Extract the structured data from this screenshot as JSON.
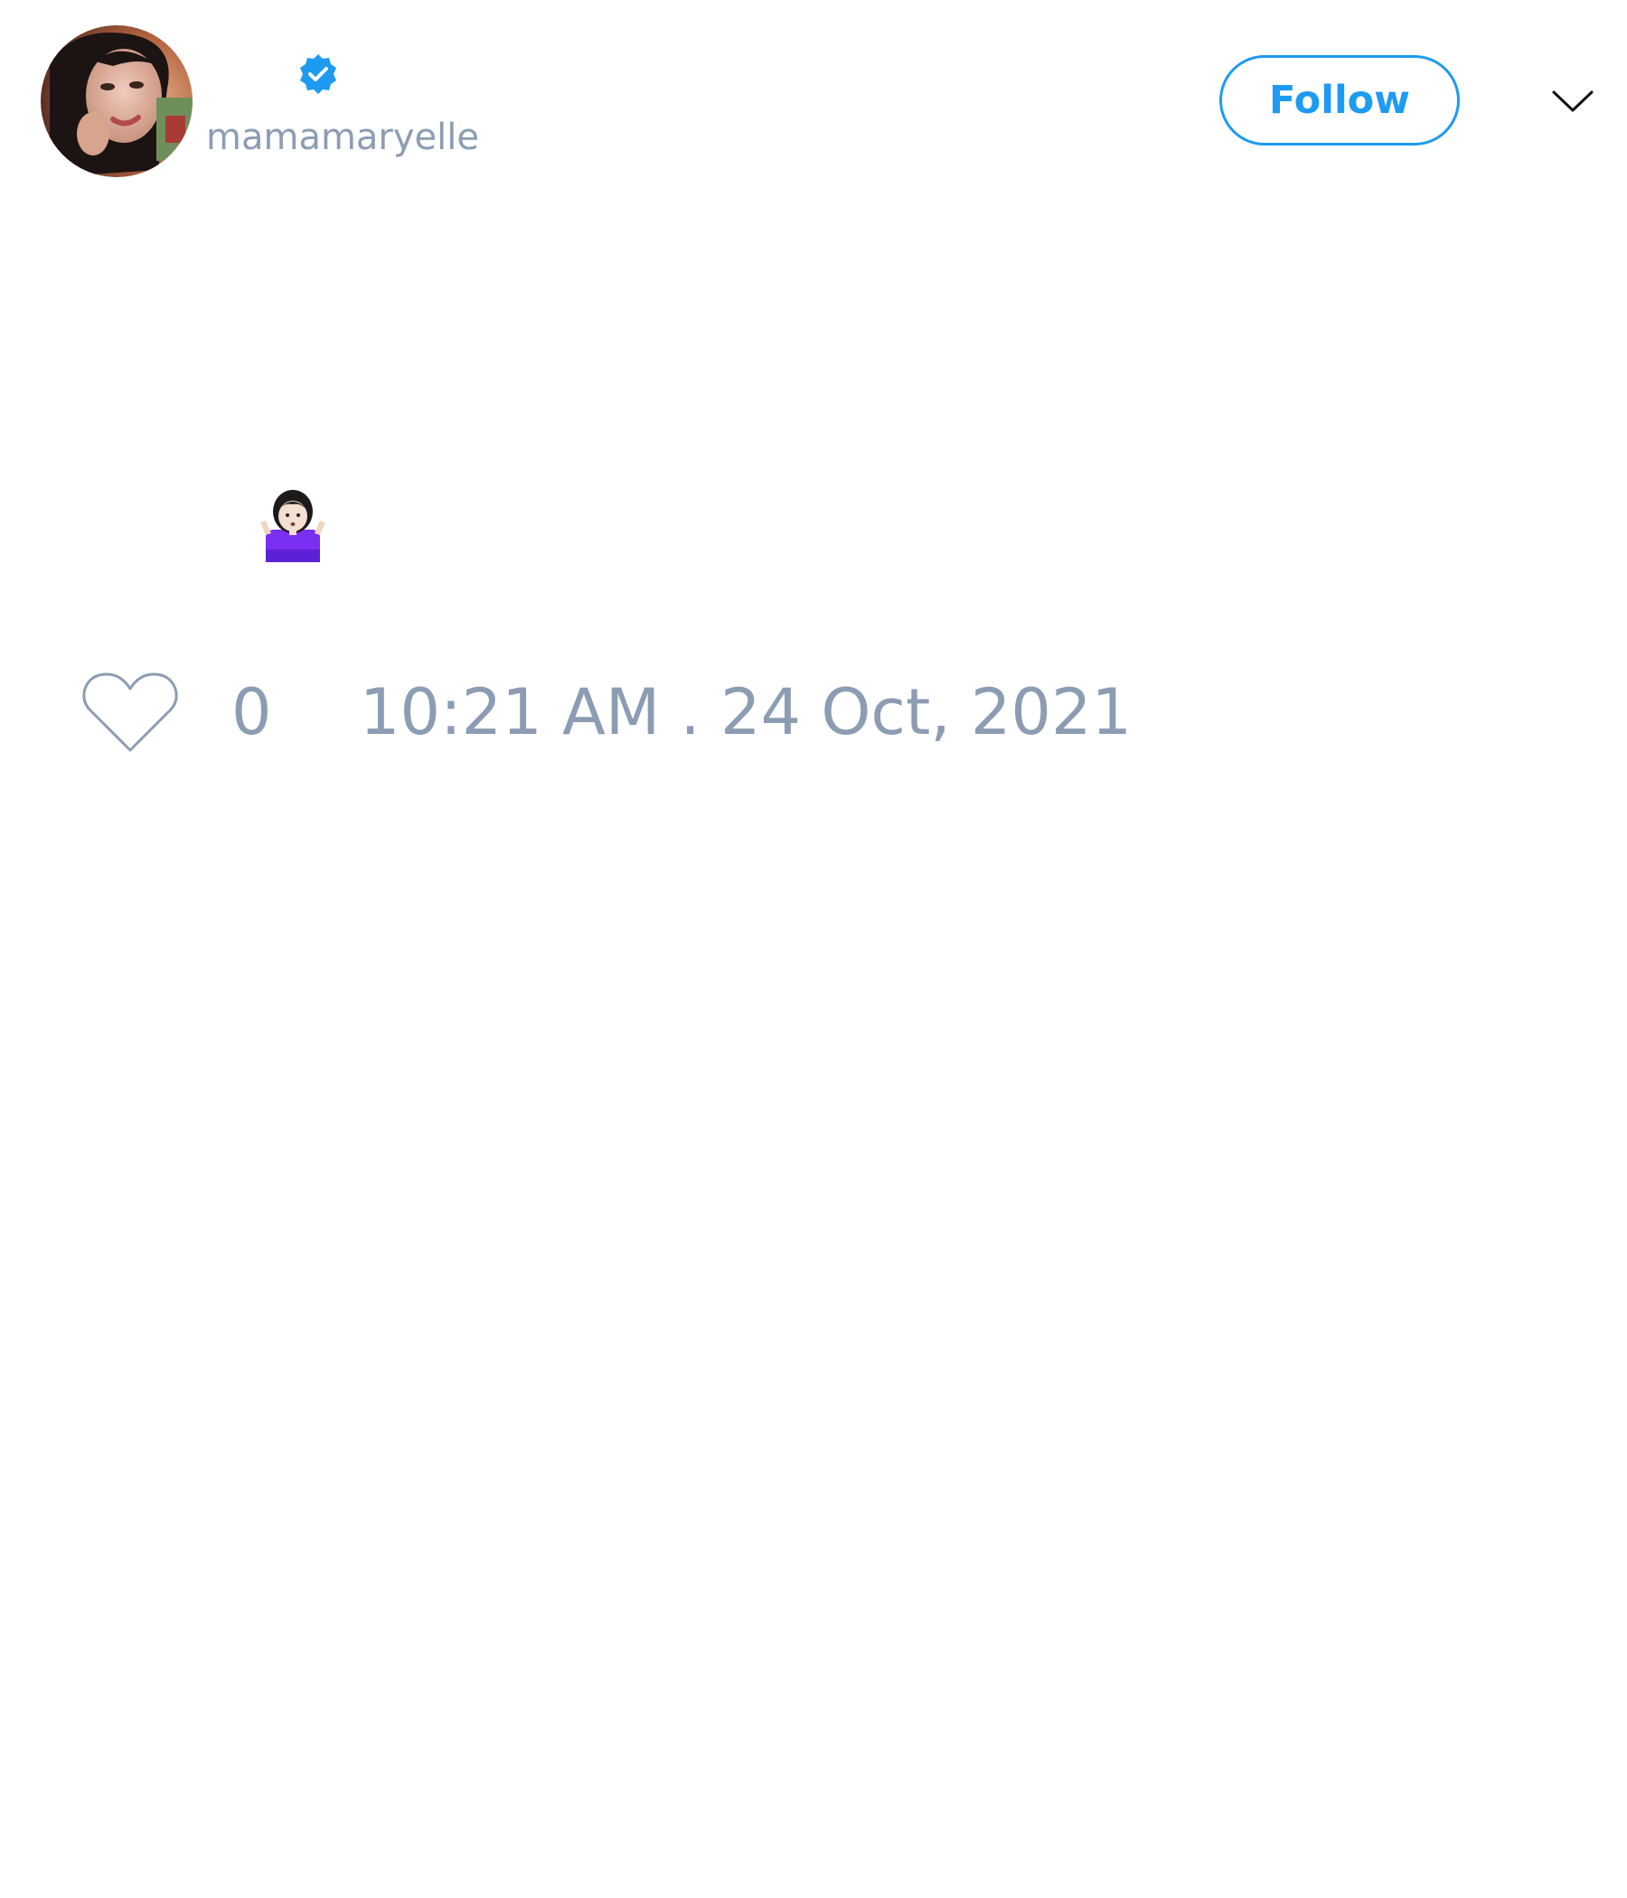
{
  "user": {
    "handle": "mamamaryelle",
    "verified": true,
    "avatar_icon": "profile-photo",
    "verified_icon": "verified-badge-icon"
  },
  "actions": {
    "follow_label": "Follow",
    "menu_icon": "chevron-down-icon"
  },
  "tweet": {
    "content_emoji": "woman-shrugging-emoji"
  },
  "footer": {
    "like_icon": "heart-outline-icon",
    "like_count": "0",
    "timestamp": "10:21 AM . 24 Oct, 2021"
  },
  "colors": {
    "accent": "#1d9bf0",
    "muted_text": "#8c9db3",
    "background": "#ffffff"
  }
}
